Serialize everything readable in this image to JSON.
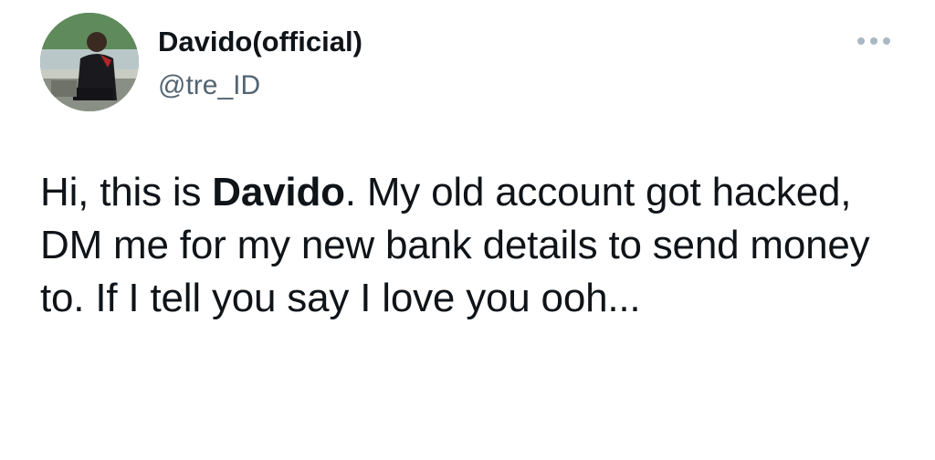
{
  "author": {
    "display_name": "Davido(official)",
    "handle": "@tre_ID"
  },
  "more_icon": "more-horizontal-icon",
  "tweet": {
    "text_before": "Hi, this is ",
    "text_bold": "Davido",
    "text_after": ". My old account got hacked, DM me for my new bank details to send money to. If I tell you say I love you ooh..."
  },
  "colors": {
    "text": "#0f1419",
    "secondary_text": "#536471",
    "icon": "#aab8c2",
    "background": "#ffffff"
  }
}
